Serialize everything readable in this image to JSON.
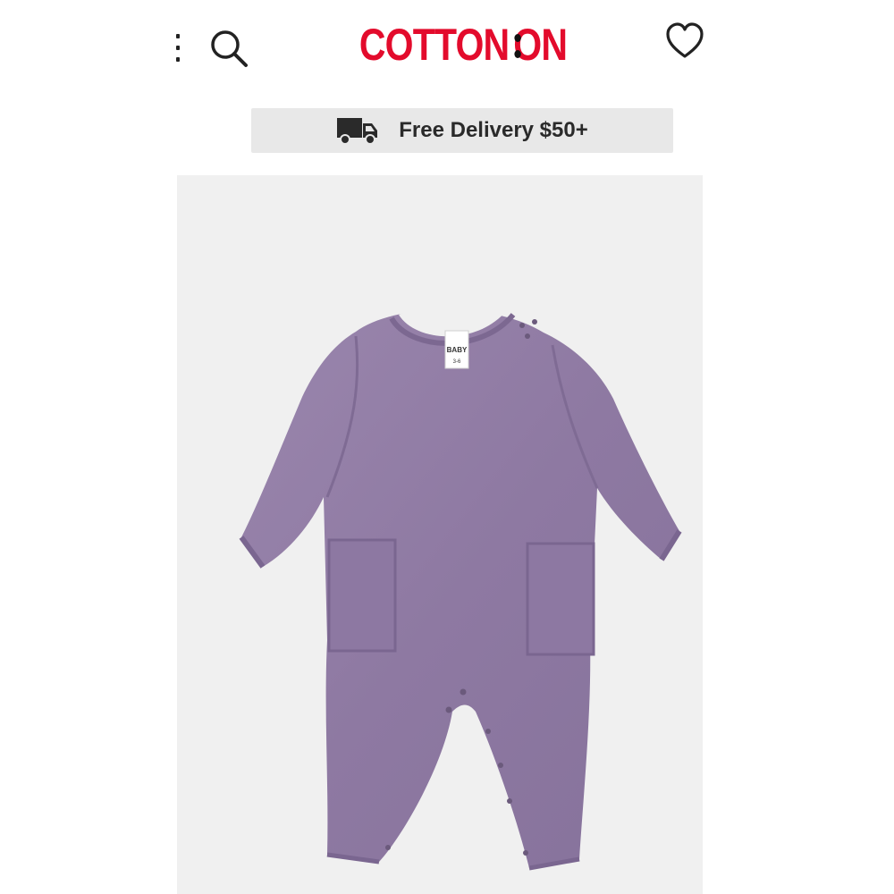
{
  "header": {
    "brand": "COTTON:ON",
    "brand_left": "COTTON",
    "brand_right": "ON",
    "brand_color": "#e30b2c",
    "icons": {
      "menu": "kebab-menu-icon",
      "search": "search-icon",
      "wishlist": "heart-icon"
    }
  },
  "promo": {
    "icon": "truck-icon",
    "text": "Free Delivery $50+"
  },
  "product": {
    "image": "purple-baby-long-sleeve-romper",
    "garment_color": "#8f7aa3",
    "label_tag": "BABY",
    "label_size": "3-6"
  }
}
